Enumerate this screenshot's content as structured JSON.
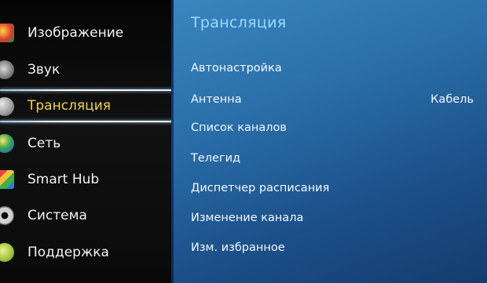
{
  "sidebar": {
    "items": [
      {
        "label": "Изображение",
        "icon": "picture-icon"
      },
      {
        "label": "Звук",
        "icon": "speaker-icon"
      },
      {
        "label": "Трансляция",
        "icon": "satellite-dish-icon",
        "active": true
      },
      {
        "label": "Сеть",
        "icon": "globe-icon"
      },
      {
        "label": "Smart Hub",
        "icon": "smart-hub-cube-icon"
      },
      {
        "label": "Система",
        "icon": "gear-icon"
      },
      {
        "label": "Поддержка",
        "icon": "support-icon"
      }
    ]
  },
  "main": {
    "title": "Трансляция",
    "items": [
      {
        "label": "Автонастройка"
      },
      {
        "label": "Антенна",
        "value": "Кабель"
      },
      {
        "label": "Список каналов"
      },
      {
        "label": "Телегид"
      },
      {
        "label": "Диспетчер расписания"
      },
      {
        "label": "Изменение канала"
      },
      {
        "label": "Изм. избранное"
      }
    ]
  },
  "colors": {
    "active_label": "#f3d34a",
    "title": "#9fd9ff",
    "panel_blue": "#2a6faa"
  }
}
